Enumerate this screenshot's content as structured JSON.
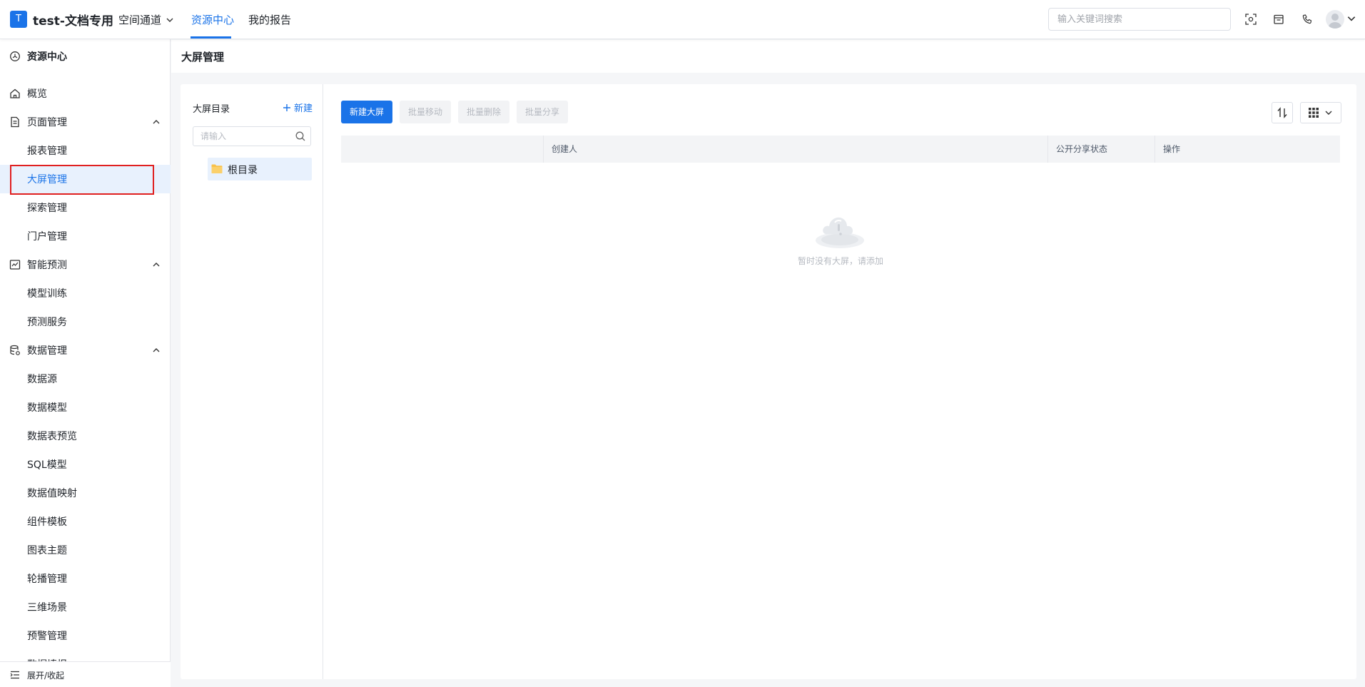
{
  "header": {
    "logo_letter": "T",
    "app_title": "test-文档专用",
    "space_select": "空间通道",
    "tabs": [
      {
        "label": "资源中心",
        "active": true
      },
      {
        "label": "我的报告",
        "active": false
      }
    ],
    "search_placeholder": "输入关键词搜索",
    "icons": [
      "scan-icon",
      "calendar-icon",
      "phone-icon",
      "user-avatar-icon"
    ]
  },
  "sidebar": {
    "section_title": "资源中心",
    "items": [
      {
        "label": "概览",
        "icon": "home-icon"
      },
      {
        "label": "页面管理",
        "icon": "document-icon",
        "expanded": true
      },
      {
        "label": "报表管理"
      },
      {
        "label": "大屏管理",
        "selected": true
      },
      {
        "label": "探索管理"
      },
      {
        "label": "门户管理"
      },
      {
        "label": "智能预测",
        "icon": "chart-icon",
        "expanded": true
      },
      {
        "label": "模型训练"
      },
      {
        "label": "预测服务"
      },
      {
        "label": "数据管理",
        "icon": "database-icon",
        "expanded": true
      },
      {
        "label": "数据源"
      },
      {
        "label": "数据模型"
      },
      {
        "label": "数据表预览"
      },
      {
        "label": "SQL模型"
      },
      {
        "label": "数据值映射"
      },
      {
        "label": "组件模板"
      },
      {
        "label": "图表主题"
      },
      {
        "label": "轮播管理"
      },
      {
        "label": "三维场景"
      },
      {
        "label": "预警管理"
      },
      {
        "label": "数据填报"
      }
    ],
    "bottom_toggle": "展开/收起"
  },
  "main": {
    "page_title": "大屏管理",
    "tree": {
      "title": "大屏目录",
      "new_label": "新建",
      "search_placeholder": "请输入",
      "root_label": "根目录"
    },
    "toolbar": {
      "new_screen": "新建大屏",
      "batch_move": "批量移动",
      "batch_delete": "批量删除",
      "batch_share": "批量分享"
    },
    "table": {
      "columns": [
        "",
        "创建人",
        "公开分享状态",
        "操作"
      ]
    },
    "empty_text": "暂时没有大屏，请添加"
  },
  "colors": {
    "accent": "#1a73e8",
    "highlight_border": "#e02020",
    "selected_bg": "#e8f1fd"
  }
}
